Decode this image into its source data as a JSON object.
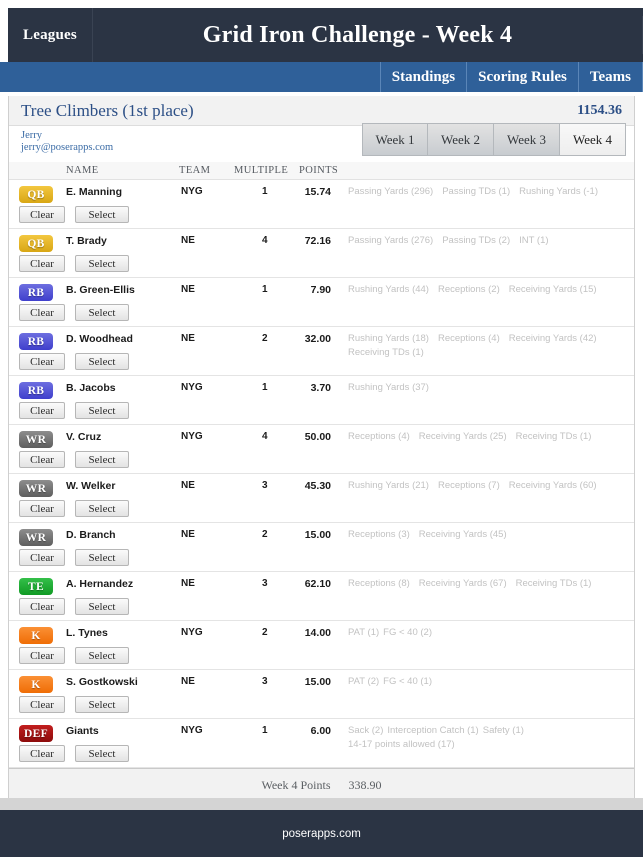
{
  "header": {
    "leagues_label": "Leagues",
    "title": "Grid Iron Challenge - Week 4"
  },
  "nav": {
    "items": [
      {
        "label": "Standings"
      },
      {
        "label": "Scoring Rules"
      },
      {
        "label": "Teams"
      }
    ]
  },
  "team": {
    "title": "Tree Climbers (1st place)",
    "total_points": "1154.36",
    "owner_name": "Jerry",
    "owner_email": "jerry@poserapps.com"
  },
  "week_tabs": [
    {
      "label": "Week 1",
      "active": false
    },
    {
      "label": "Week 2",
      "active": false
    },
    {
      "label": "Week 3",
      "active": false
    },
    {
      "label": "Week 4",
      "active": true
    }
  ],
  "columns": {
    "name": "NAME",
    "team": "TEAM",
    "multiple": "MULTIPLE",
    "points": "POINTS"
  },
  "buttons": {
    "clear": "Clear",
    "select": "Select"
  },
  "players": [
    {
      "position": "QB",
      "pos_class": "qb",
      "name": "E. Manning",
      "team": "NYG",
      "multiple": "1",
      "points": "15.74",
      "stats": [
        "Passing Yards (296)",
        "Passing TDs (1)",
        "Rushing Yards (-1)"
      ]
    },
    {
      "position": "QB",
      "pos_class": "qb",
      "name": "T. Brady",
      "team": "NE",
      "multiple": "4",
      "points": "72.16",
      "stats": [
        "Passing Yards (276)",
        "Passing TDs (2)",
        "INT (1)"
      ]
    },
    {
      "position": "RB",
      "pos_class": "rb",
      "name": "B. Green-Ellis",
      "team": "NE",
      "multiple": "1",
      "points": "7.90",
      "stats": [
        "Rushing Yards (44)",
        "Receptions (2)",
        "Receiving Yards (15)"
      ]
    },
    {
      "position": "RB",
      "pos_class": "rb",
      "name": "D. Woodhead",
      "team": "NE",
      "multiple": "2",
      "points": "32.00",
      "stats": [
        "Rushing Yards (18)",
        "Receptions (4)",
        "Receiving Yards (42)",
        "Receiving TDs (1)"
      ]
    },
    {
      "position": "RB",
      "pos_class": "rb",
      "name": "B. Jacobs",
      "team": "NYG",
      "multiple": "1",
      "points": "3.70",
      "stats": [
        "Rushing Yards (37)"
      ]
    },
    {
      "position": "WR",
      "pos_class": "wr",
      "name": "V. Cruz",
      "team": "NYG",
      "multiple": "4",
      "points": "50.00",
      "stats": [
        "Receptions (4)",
        "Receiving Yards (25)",
        "Receiving TDs (1)"
      ]
    },
    {
      "position": "WR",
      "pos_class": "wr",
      "name": "W. Welker",
      "team": "NE",
      "multiple": "3",
      "points": "45.30",
      "stats": [
        "Rushing Yards (21)",
        "Receptions (7)",
        "Receiving Yards (60)"
      ]
    },
    {
      "position": "WR",
      "pos_class": "wr",
      "name": "D. Branch",
      "team": "NE",
      "multiple": "2",
      "points": "15.00",
      "stats": [
        "Receptions (3)",
        "Receiving Yards (45)"
      ]
    },
    {
      "position": "TE",
      "pos_class": "te",
      "name": "A. Hernandez",
      "team": "NE",
      "multiple": "3",
      "points": "62.10",
      "stats": [
        "Receptions (8)",
        "Receiving Yards (67)",
        "Receiving TDs (1)"
      ]
    },
    {
      "position": "K",
      "pos_class": "k",
      "name": "L. Tynes",
      "team": "NYG",
      "multiple": "2",
      "points": "14.00",
      "stats": [
        "PAT (1)",
        "FG < 40 (2)"
      ],
      "flow": true
    },
    {
      "position": "K",
      "pos_class": "k",
      "name": "S. Gostkowski",
      "team": "NE",
      "multiple": "3",
      "points": "15.00",
      "stats": [
        "PAT (2)",
        "FG < 40 (1)"
      ],
      "flow": true
    },
    {
      "position": "DEF",
      "pos_class": "def",
      "name": "Giants",
      "team": "NYG",
      "multiple": "1",
      "points": "6.00",
      "stats": [
        "Sack (2)",
        "Interception Catch (1)",
        "Safety (1)",
        "14-17 points allowed (17)"
      ],
      "flow": true
    }
  ],
  "totals": {
    "label": "Week 4 Points",
    "value": "338.90"
  },
  "footer": {
    "text": "poserapps.com"
  }
}
